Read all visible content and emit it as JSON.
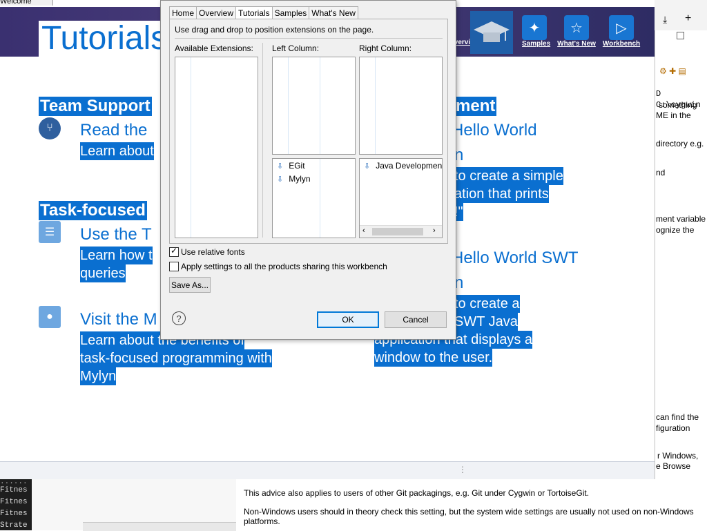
{
  "welcome": {
    "tab_label": "Welcome",
    "title": "Tutorials",
    "nav": [
      {
        "label": "Overview",
        "icon": "overview-icon"
      },
      {
        "label": "",
        "icon": "graduation-cap-icon"
      },
      {
        "label": "Samples",
        "icon": "magic-wand-icon"
      },
      {
        "label": "What's New",
        "icon": "star-icon"
      },
      {
        "label": "Workbench",
        "icon": "play-icon"
      }
    ],
    "left_sections": [
      {
        "heading": "Team Support",
        "link_title": "Read the",
        "desc": [
          "Learn about"
        ]
      },
      {
        "heading": "Task-focused",
        "link_title": "Use the T",
        "desc": [
          "Learn how t",
          "queries"
        ]
      },
      {
        "heading": "",
        "link_title": "Visit the M",
        "desc": [
          "Learn about the benefits of",
          "task-focused programming with",
          "Mylyn"
        ]
      }
    ],
    "right_heading": "ment",
    "right_items": [
      {
        "title": "Hello World",
        "sub": "n",
        "desc": [
          "to create a simple",
          "ation that prints",
          "!\""
        ]
      },
      {
        "title": "Hello World SWT",
        "sub": "n",
        "desc": [
          "to create a",
          "SWT Java",
          "application that displays a",
          "window to the user."
        ]
      }
    ]
  },
  "right_pane": {
    "lines": [
      "D C:\\cygwin",
      "something",
      "ME in the",
      "directory e.g.",
      "nd",
      "ment variable",
      "ognize the",
      "can find the",
      "figuration",
      "r Windows,",
      "e Browse"
    ]
  },
  "bottom_pane": {
    "para1": "This advice also applies to users of other Git packagings, e.g. Git under Cygwin or TortoiseGit.",
    "para2": "Non-Windows users should in theory check this setting, but the system wide settings are usually not used on non-Windows platforms.",
    "console": [
      "Fitnes",
      "Fitnes",
      "Fitnes",
      "Strate"
    ]
  },
  "dialog": {
    "tabs": [
      "Home",
      "Overview",
      "Tutorials",
      "Samples",
      "What's New"
    ],
    "active_tab": "Tutorials",
    "instruction": "Use drag and drop to position extensions on the page.",
    "available_label": "Available Extensions:",
    "left_label": "Left Column:",
    "right_label": "Right Column:",
    "left_items": [
      "EGit",
      "Mylyn"
    ],
    "right_items": [
      "Java Development"
    ],
    "relative_fonts_label": "Use relative fonts",
    "relative_fonts_checked": true,
    "apply_all_label": "Apply settings to all the products sharing this workbench",
    "apply_all_checked": false,
    "save_as_label": "Save As...",
    "ok_label": "OK",
    "cancel_label": "Cancel"
  }
}
